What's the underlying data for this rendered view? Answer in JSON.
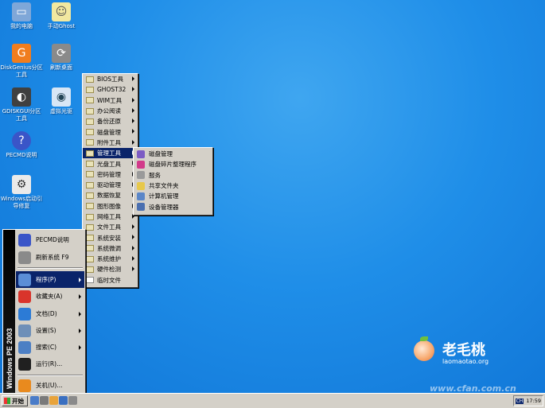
{
  "desktop_icons": [
    {
      "label": "我的电脑",
      "icon": "computer-icon",
      "color": "#7fa7d8"
    },
    {
      "label": "手动Ghost",
      "icon": "ghost-icon",
      "color": "#f2e8a0"
    },
    {
      "label": "DiskGenius分区工具",
      "icon": "diskgenius-icon",
      "color": "#f07d1e"
    },
    {
      "label": "刷新桌面",
      "icon": "refresh-desktop-icon",
      "color": "#8a8a8a"
    },
    {
      "label": "GDISKGUI分区工具",
      "icon": "gdisk-icon",
      "color": "#404040"
    },
    {
      "label": "虚拟光驱",
      "icon": "virtual-drive-icon",
      "color": "#d8e6f5"
    },
    {
      "label": "PECMD说明",
      "icon": "help-icon",
      "color": "#3a55c8"
    },
    {
      "label": "Windows启动引导修复",
      "icon": "boot-repair-icon",
      "color": "#eaeaea"
    }
  ],
  "programs_menu": [
    "BIOS工具",
    "GHOST32",
    "WIM工具",
    "办公阅读",
    "备份还原",
    "磁盘管理",
    "附件工具",
    "管理工具",
    "光盘工具",
    "密码管理",
    "驱动管理",
    "数据恢复",
    "图形图像",
    "网络工具",
    "文件工具",
    "系统安装",
    "系统微调",
    "系统维护",
    "硬件检测",
    "临时文件"
  ],
  "programs_selected": "管理工具",
  "admin_tools_menu": [
    {
      "label": "磁盘管理",
      "icon": "disk-management-icon",
      "color": "#7c5cc4"
    },
    {
      "label": "磁盘碎片整理程序",
      "icon": "defrag-icon",
      "color": "#d23a8a"
    },
    {
      "label": "服务",
      "icon": "services-icon",
      "color": "#9a9a9a"
    },
    {
      "label": "共享文件夹",
      "icon": "shared-folder-icon",
      "color": "#e7c84a"
    },
    {
      "label": "计算机管理",
      "icon": "computer-management-icon",
      "color": "#5a86c8"
    },
    {
      "label": "设备管理器",
      "icon": "device-manager-icon",
      "color": "#4a6fb0"
    }
  ],
  "start_menu": {
    "sidebar_text": "Windows PE 2003",
    "items": [
      {
        "label": "PECMD说明",
        "icon": "help-icon",
        "color": "#3a55c8",
        "arrow": false
      },
      {
        "label": "刷新系统 F9",
        "icon": "refresh-system-icon",
        "color": "#8a8a8a",
        "arrow": false
      },
      {
        "label": "程序(P)",
        "icon": "programs-icon",
        "color": "#5b8ed6",
        "arrow": true,
        "selected": true
      },
      {
        "label": "收藏夹(A)",
        "icon": "favorites-icon",
        "color": "#d9342b",
        "arrow": true
      },
      {
        "label": "文档(D)",
        "icon": "documents-icon",
        "color": "#2c7bd6",
        "arrow": true
      },
      {
        "label": "设置(S)",
        "icon": "settings-icon",
        "color": "#6e8fb8",
        "arrow": true
      },
      {
        "label": "搜索(C)",
        "icon": "search-icon",
        "color": "#4c7fc4",
        "arrow": true
      },
      {
        "label": "运行(R)...",
        "icon": "run-icon",
        "color": "#202020",
        "arrow": false
      },
      {
        "label": "关机(U)...",
        "icon": "shutdown-icon",
        "color": "#e98a1e",
        "arrow": false
      }
    ]
  },
  "taskbar": {
    "start_label": "开始",
    "quick_launch": [
      {
        "icon": "quicklaunch-1-icon",
        "color": "#4a7cc8"
      },
      {
        "icon": "quicklaunch-2-icon",
        "color": "#7a7a7a"
      },
      {
        "icon": "quicklaunch-3-icon",
        "color": "#e8a33a"
      },
      {
        "icon": "quicklaunch-4-icon",
        "color": "#3a6fc0"
      },
      {
        "icon": "quicklaunch-5-icon",
        "color": "#8a8a8a"
      }
    ],
    "ime": "CH",
    "clock": "17:59"
  },
  "branding": {
    "name": "老毛桃",
    "url": "laomaotao.org",
    "watermark": "www.cfan.com.cn"
  }
}
